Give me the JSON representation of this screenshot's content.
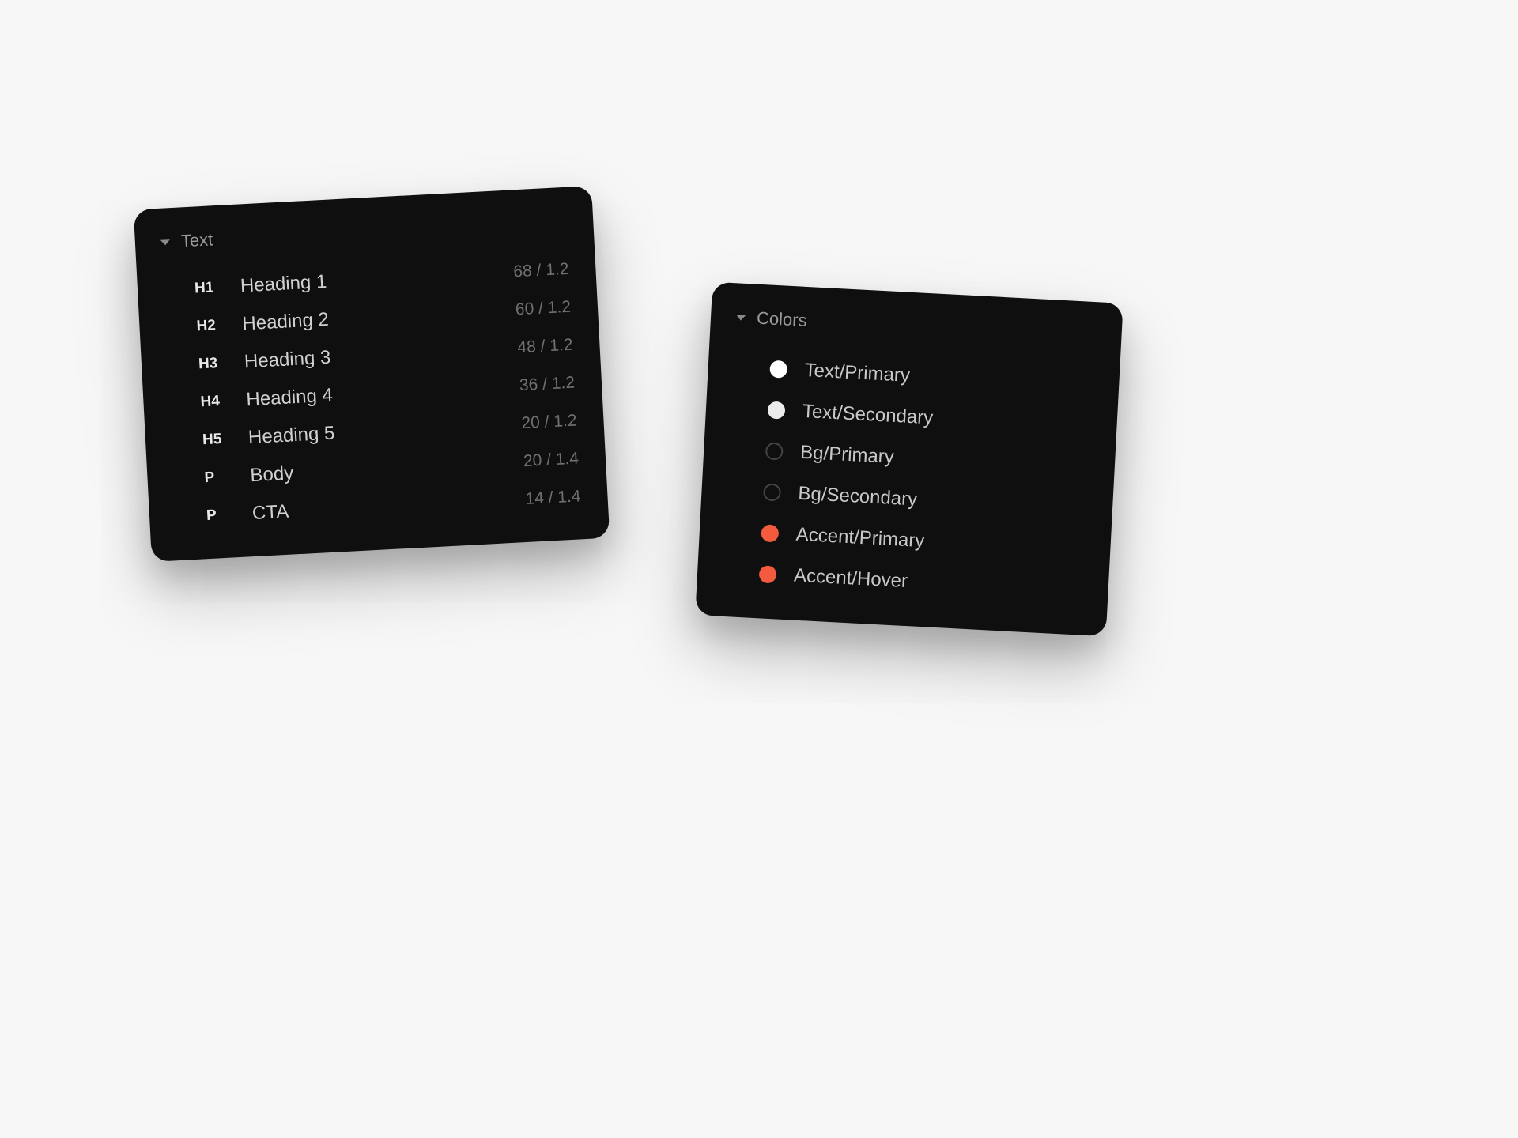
{
  "text_panel": {
    "title": "Text",
    "rows": [
      {
        "tag": "H1",
        "label": "Heading 1",
        "meta": "68 / 1.2"
      },
      {
        "tag": "H2",
        "label": "Heading 2",
        "meta": "60 / 1.2"
      },
      {
        "tag": "H3",
        "label": "Heading 3",
        "meta": "48 / 1.2"
      },
      {
        "tag": "H4",
        "label": "Heading 4",
        "meta": "36 / 1.2"
      },
      {
        "tag": "H5",
        "label": "Heading 5",
        "meta": "20 / 1.2"
      },
      {
        "tag": "P",
        "label": "Body",
        "meta": "20 / 1.4"
      },
      {
        "tag": "P",
        "label": "CTA",
        "meta": "14 / 1.4"
      }
    ]
  },
  "colors_panel": {
    "title": "Colors",
    "rows": [
      {
        "label": "Text/Primary",
        "swatch": "#ffffff",
        "filled": true
      },
      {
        "label": "Text/Secondary",
        "swatch": "#ebebeb",
        "filled": true
      },
      {
        "label": "Bg/Primary",
        "swatch": "#000000",
        "filled": false
      },
      {
        "label": "Bg/Secondary",
        "swatch": "#000000",
        "filled": false
      },
      {
        "label": "Accent/Primary",
        "swatch": "#f45b3e",
        "filled": true
      },
      {
        "label": "Accent/Hover",
        "swatch": "#f45b3e",
        "filled": true
      }
    ]
  }
}
